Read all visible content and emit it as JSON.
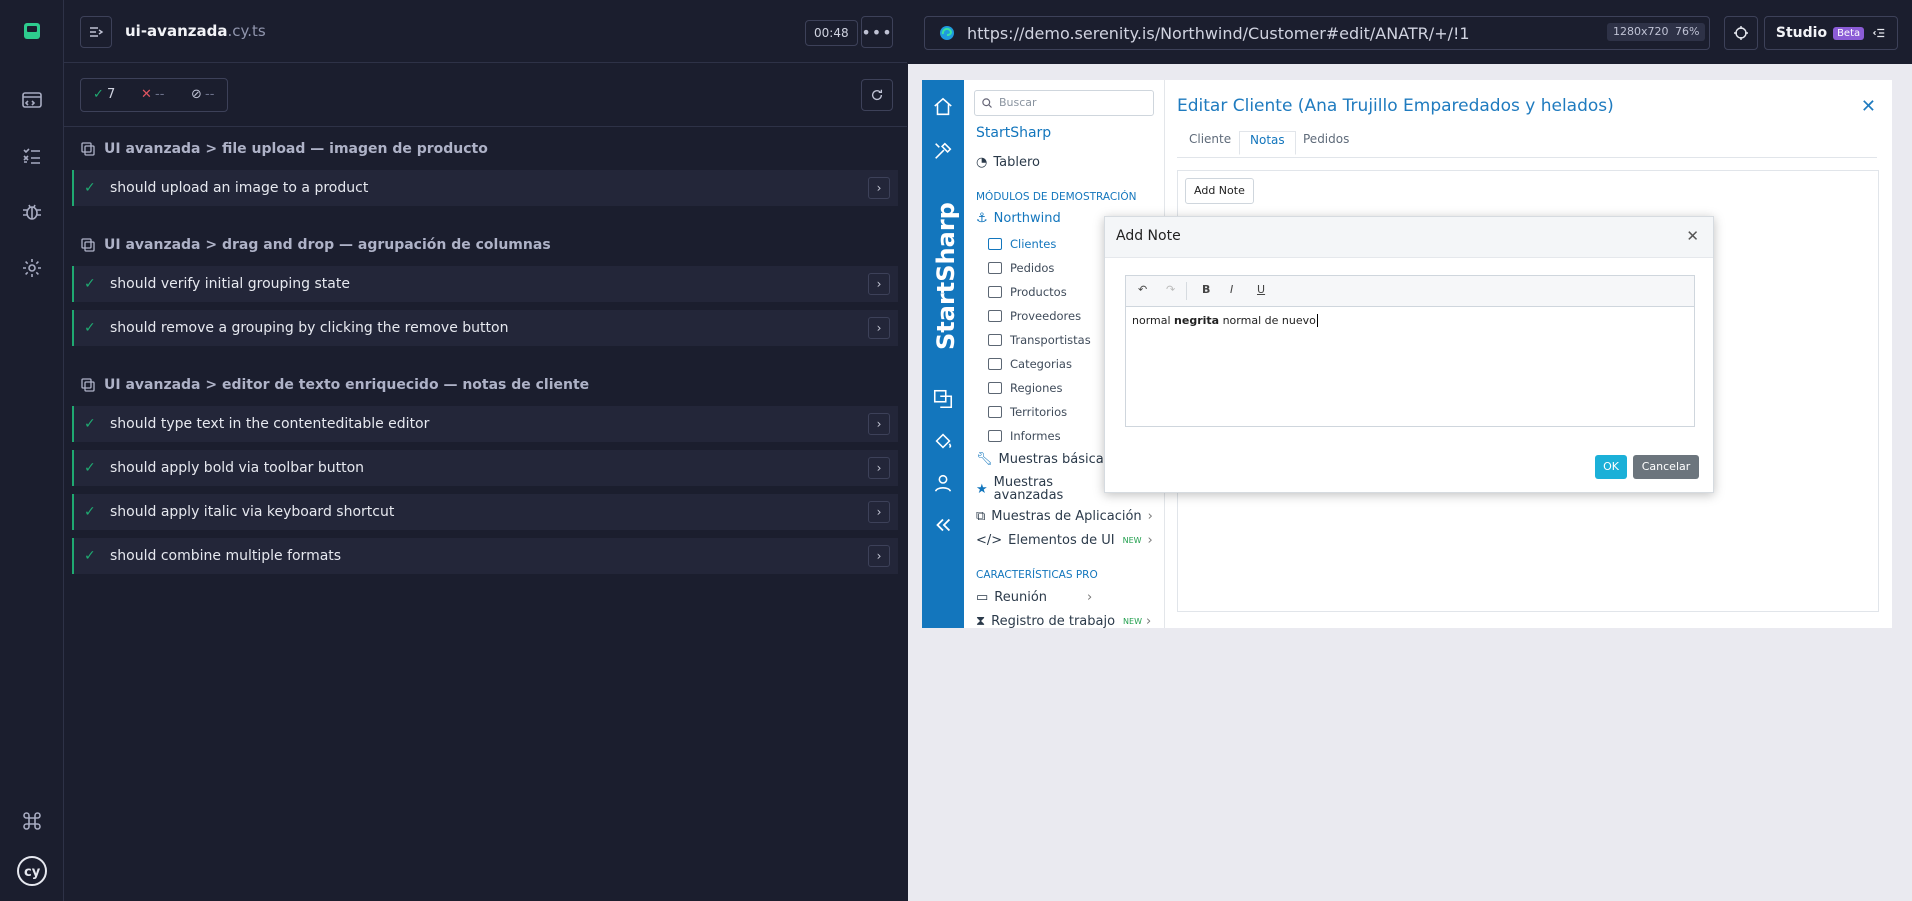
{
  "reporter": {
    "spec_name_bold": "ui-avanzada",
    "spec_name_ext": ".cy.ts",
    "timer": "00:48",
    "stats": {
      "passed": "7",
      "failed": "--",
      "pending": "--"
    },
    "suites": [
      {
        "title": "UI avanzada > file upload — imagen de producto",
        "tests": [
          "should upload an image to a product"
        ]
      },
      {
        "title": "UI avanzada > drag and drop — agrupación de columnas",
        "tests": [
          "should verify initial grouping state",
          "should remove a grouping by clicking the remove button"
        ]
      },
      {
        "title": "UI avanzada > editor de texto enriquecido — notas de cliente",
        "tests": [
          "should type text in the contenteditable editor",
          "should apply bold via toolbar button",
          "should apply italic via keyboard shortcut",
          "should combine multiple formats"
        ]
      }
    ]
  },
  "browser": {
    "url": "https://demo.serenity.is/Northwind/Customer#edit/ANATR/+/!1",
    "viewport": "1280x720",
    "zoom": "76%",
    "studio_label": "Studio",
    "studio_badge": "Beta"
  },
  "app": {
    "brand_vertical": "StartSharp",
    "search_placeholder": "Buscar",
    "brand": "StartSharp",
    "dashboard": "Tablero",
    "section_demo": "MÓDULOS DE DEMOSTRACIÓN",
    "northwind": "Northwind",
    "northwind_items": [
      "Clientes",
      "Pedidos",
      "Productos",
      "Proveedores",
      "Transportistas",
      "Categorias",
      "Regiones",
      "Territorios",
      "Informes"
    ],
    "basic_samples": "Muestras básicas",
    "advanced_samples": "Muestras avanzadas",
    "app_samples": "Muestras de Aplicación",
    "ui_elements": "Elementos de UI",
    "new_badge": "NEW",
    "section_pro": "CARACTERÍSTICAS PRO",
    "meeting": "Reunión",
    "work_log": "Registro de trabajo",
    "page_title": "Editar Cliente (Ana Trujillo Emparedados y helados)",
    "tabs": [
      "Cliente",
      "Notas",
      "Pedidos"
    ],
    "add_note_button": "Add Note",
    "dialog": {
      "title": "Add Note",
      "text_normal": "normal ",
      "text_bold": "negrita",
      "text_after": " normal de nuevo",
      "ok": "OK",
      "cancel": "Cancelar"
    }
  },
  "colors": {
    "pass": "#1fa971",
    "app_blue": "#1376bd",
    "ok": "#1bb0d8"
  }
}
